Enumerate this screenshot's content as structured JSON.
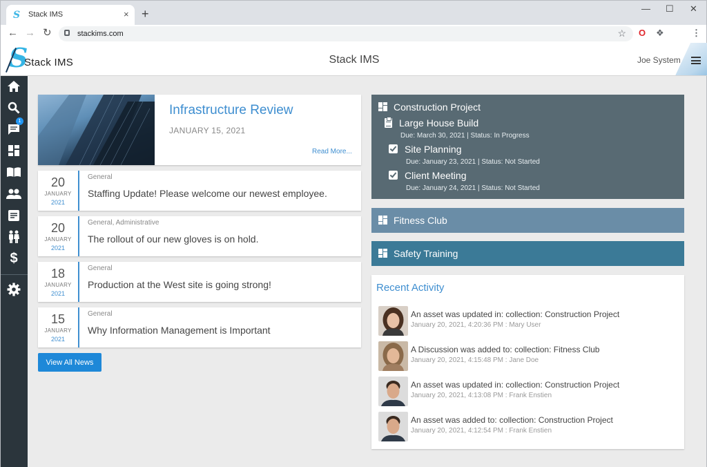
{
  "browser": {
    "tab_title": "Stack IMS",
    "tab_close": "×",
    "new_tab": "+",
    "url": "stackims.com",
    "window_controls": [
      "—",
      "☐",
      "✕"
    ]
  },
  "header": {
    "logo_letter": "S",
    "logo_text": "Stack IMS",
    "title": "Stack IMS",
    "user": "Joe System"
  },
  "sidebar": {
    "items": [
      {
        "icon": "home-icon"
      },
      {
        "icon": "search-icon"
      },
      {
        "icon": "chat-icon",
        "badge": "1"
      },
      {
        "icon": "dashboard-icon"
      },
      {
        "icon": "book-icon"
      },
      {
        "icon": "people-icon"
      },
      {
        "icon": "document-icon"
      },
      {
        "icon": "family-icon"
      },
      {
        "icon": "dollar-icon"
      },
      {
        "icon": "gear-icon"
      }
    ],
    "dollar_glyph": "$"
  },
  "featured": {
    "title": "Infrastructure Review",
    "date": "JANUARY 15, 2021",
    "read_more": "Read More..."
  },
  "news": [
    {
      "day": "20",
      "month": "JANUARY",
      "year": "2021",
      "category": "General",
      "headline": "Staffing Update! Please welcome our newest employee."
    },
    {
      "day": "20",
      "month": "JANUARY",
      "year": "2021",
      "category": "General, Administrative",
      "headline": "The rollout of our new gloves is on hold."
    },
    {
      "day": "18",
      "month": "JANUARY",
      "year": "2021",
      "category": "General",
      "headline": "Production at the West site is going strong!"
    },
    {
      "day": "15",
      "month": "JANUARY",
      "year": "2021",
      "category": "General",
      "headline": "Why Information Management is Important"
    }
  ],
  "view_all_label": "View All News",
  "collections": {
    "construction": {
      "title": "Construction Project",
      "project": {
        "title": "Large House Build",
        "meta": "Due: March 30, 2021 | Status: In Progress"
      },
      "tasks": [
        {
          "title": "Site Planning",
          "meta": "Due: January 23, 2021 | Status: Not Started"
        },
        {
          "title": "Client Meeting",
          "meta": "Due: January 24, 2021 | Status: Not Started"
        }
      ]
    },
    "fitness": {
      "title": "Fitness Club"
    },
    "safety": {
      "title": "Safety Training"
    }
  },
  "activity": {
    "title": "Recent Activity",
    "items": [
      {
        "text": "An asset was updated in: collection: Construction Project",
        "meta": "January 20, 2021, 4:20:36 PM : Mary User"
      },
      {
        "text": "A Discussion was added to: collection: Fitness Club",
        "meta": "January 20, 2021, 4:15:48 PM : Jane Doe"
      },
      {
        "text": "An asset was updated in: collection: Construction Project",
        "meta": "January 20, 2021, 4:13:08 PM : Frank Enstien"
      },
      {
        "text": "An asset was added to: collection: Construction Project",
        "meta": "January 20, 2021, 4:12:54 PM : Frank Enstien"
      }
    ]
  },
  "colors": {
    "accent": "#3e8ed0",
    "sidebar": "#2b353c",
    "construction": "#586a73",
    "fitness": "#6a8da7",
    "safety": "#3b7a97",
    "button": "#1e88d8"
  }
}
